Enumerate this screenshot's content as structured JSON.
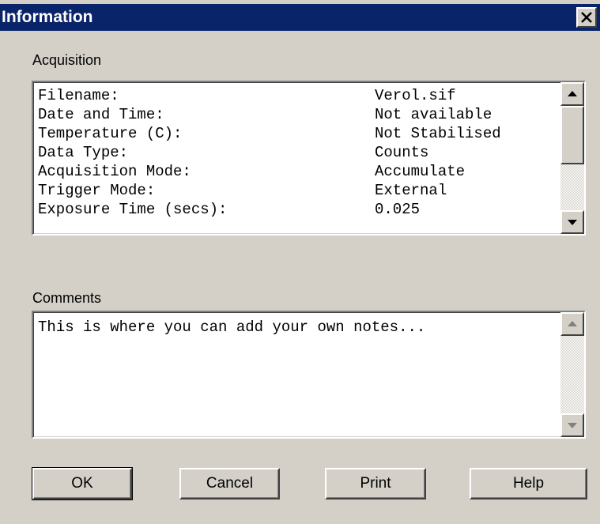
{
  "window": {
    "title": "Information"
  },
  "acquisition": {
    "label": "Acquisition",
    "rows": [
      {
        "key": "Filename:",
        "value": "Verol.sif"
      },
      {
        "key": "Date and Time:",
        "value": "Not available"
      },
      {
        "key": "Temperature (C):",
        "value": "Not Stabilised"
      },
      {
        "key": "Data Type:",
        "value": "Counts"
      },
      {
        "key": "Acquisition Mode:",
        "value": "Accumulate"
      },
      {
        "key": "Trigger Mode:",
        "value": "External"
      },
      {
        "key": "Exposure Time (secs):",
        "value": "0.025"
      }
    ]
  },
  "comments": {
    "label": "Comments",
    "text": "This is where you can add your own notes..."
  },
  "buttons": {
    "ok": "OK",
    "cancel": "Cancel",
    "print": "Print",
    "help": "Help"
  },
  "colors": {
    "titlebar": "#0a246a",
    "face": "#d4d0c8"
  },
  "icons": [
    "close-icon",
    "scroll-up-arrow-icon",
    "scroll-down-arrow-icon"
  ]
}
